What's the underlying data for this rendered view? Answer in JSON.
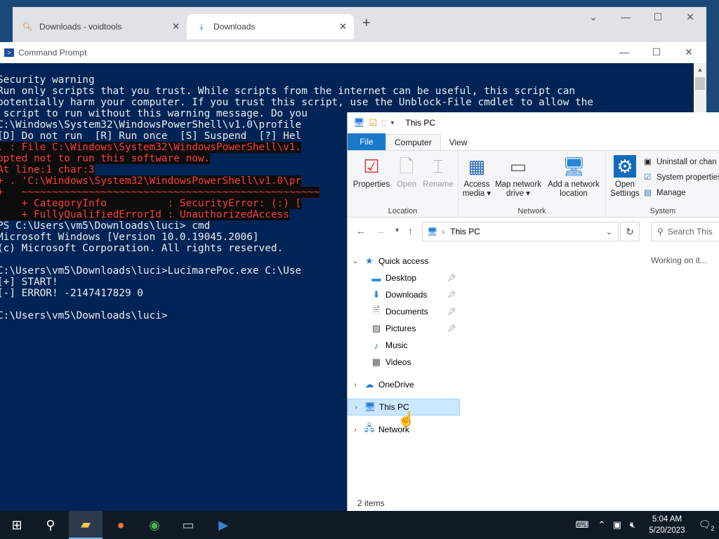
{
  "browser": {
    "tabs": [
      {
        "title": "Downloads - voidtools",
        "icon": "magnifier-icon"
      },
      {
        "title": "Downloads",
        "icon": "download-arrow-icon"
      }
    ],
    "new_tab": "+",
    "controls": [
      "⌄",
      "—",
      "☐",
      "✕"
    ]
  },
  "cmd": {
    "title": "Command Prompt",
    "controls": [
      "—",
      "☐",
      "✕"
    ],
    "lines": [
      {
        "text": "Security warning",
        "style": "normal"
      },
      {
        "text": "Run only scripts that you trust. While scripts from the internet can be useful, this script can",
        "style": "normal"
      },
      {
        "text": "potentially harm your computer. If you trust this script, use the Unblock-File cmdlet to allow the",
        "style": "normal"
      },
      {
        "text": " script to run without this warning message. Do you",
        "style": "normal"
      },
      {
        "text": "C:\\Windows\\System32\\WindowsPowerShell\\v1.0\\profile",
        "style": "normal"
      },
      {
        "text": "[D] Do not run  [R] Run once  [S] Suspend  [?] Hel",
        "style": "normal"
      },
      {
        "text": ". : File C:\\Windows\\System32\\WindowsPowerShell\\v1.",
        "style": "err"
      },
      {
        "text": "opted not to run this software now.",
        "style": "err"
      },
      {
        "text": "At line:1 char:3",
        "style": "err"
      },
      {
        "text": "+ . 'C:\\Windows\\System32\\WindowsPowerShell\\v1.0\\pr",
        "style": "err"
      },
      {
        "text": "+   ~~~~~~~~~~~~~~~~~~~~~~~~~~~~~~~~~~~~~~~~~~~~~~~~~",
        "style": "err"
      },
      {
        "text": "    + CategoryInfo          : SecurityError: (:) [",
        "style": "err"
      },
      {
        "text": "    + FullyQualifiedErrorId : UnauthorizedAccess",
        "style": "err"
      },
      {
        "text": "PS C:\\Users\\vm5\\Downloads\\luci> cmd",
        "style": "normal"
      },
      {
        "text": "Microsoft Windows [Version 10.0.19045.2006]",
        "style": "normal"
      },
      {
        "text": "(c) Microsoft Corporation. All rights reserved.",
        "style": "normal"
      },
      {
        "text": "",
        "style": "normal"
      },
      {
        "text": "C:\\Users\\vm5\\Downloads\\luci>LucimarePoc.exe C:\\Use",
        "style": "normal"
      },
      {
        "text": "[+] START!",
        "style": "normal"
      },
      {
        "text": "[-] ERROR! -2147417829 0",
        "style": "normal"
      },
      {
        "text": "",
        "style": "normal"
      },
      {
        "text": "C:\\Users\\vm5\\Downloads\\luci>",
        "style": "normal"
      }
    ]
  },
  "explorer": {
    "title": "This PC",
    "ribbon_tabs": {
      "file": "File",
      "computer": "Computer",
      "view": "View"
    },
    "location": {
      "label": "Location",
      "properties": "Properties",
      "open": "Open",
      "rename": "Rename"
    },
    "network": {
      "label": "Network",
      "access_media": "Access media",
      "map_drive": "Map network drive",
      "add_location": "Add a network location"
    },
    "system": {
      "label": "System",
      "open_settings": "Open Settings",
      "uninstall": "Uninstall or chan",
      "properties": "System properties",
      "manage": "Manage"
    },
    "address": "This PC",
    "search_placeholder": "Search This",
    "working": "Working on it...",
    "nav": {
      "quick_access": "Quick access",
      "desktop": "Desktop",
      "downloads": "Downloads",
      "documents": "Documents",
      "pictures": "Pictures",
      "music": "Music",
      "videos": "Videos",
      "onedrive": "OneDrive",
      "this_pc": "This PC",
      "network": "Network"
    },
    "status": "2 items"
  },
  "taskbar": {
    "time": "5:04 AM",
    "date": "5/20/2023",
    "notifications": "2"
  }
}
